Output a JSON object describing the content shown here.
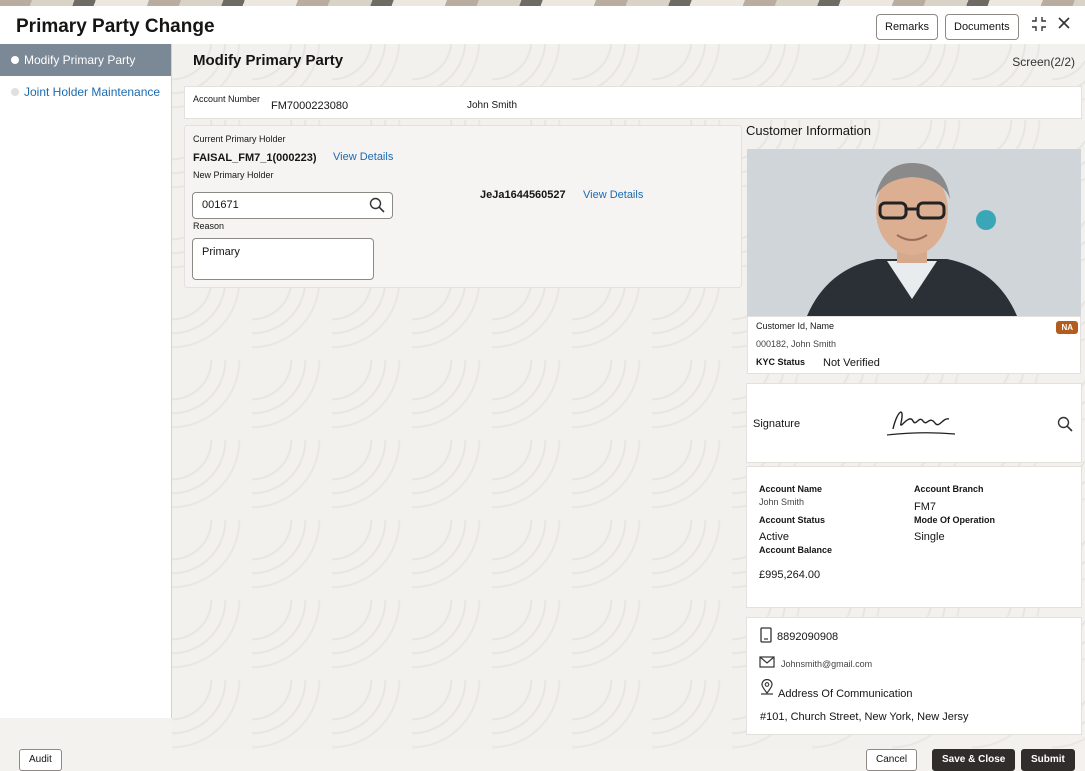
{
  "header": {
    "title": "Primary Party Change",
    "remarks_label": "Remarks",
    "documents_label": "Documents"
  },
  "sidebar": {
    "items": [
      {
        "label": "Modify Primary Party"
      },
      {
        "label": "Joint Holder Maintenance"
      }
    ]
  },
  "main": {
    "section_title": "Modify Primary Party",
    "screen_indicator": "Screen(2/2)",
    "account": {
      "number_label": "Account Number",
      "number_value": "FM7000223080",
      "name": "John Smith"
    },
    "holder": {
      "current_label": "Current Primary Holder",
      "current_value": "FAISAL_FM7_1(000223)",
      "view_details": "View Details",
      "new_label": "New Primary Holder",
      "new_value": "001671",
      "new_id": "JeJa1644560527",
      "reason_label": "Reason",
      "reason_value": "Primary"
    }
  },
  "customer": {
    "title": "Customer Information",
    "id_name_label": "Customer Id, Name",
    "id_name_value": "000182, John Smith",
    "badge": "NA",
    "kyc_label": "KYC Status",
    "kyc_value": "Not Verified",
    "signature_label": "Signature",
    "account_name_label": "Account Name",
    "account_name_value": "John Smith",
    "account_branch_label": "Account Branch",
    "account_branch_value": "FM7",
    "account_status_label": "Account Status",
    "account_status_value": "Active",
    "mode_label": "Mode Of Operation",
    "mode_value": "Single",
    "balance_label": "Account Balance",
    "balance_value": "£995,264.00",
    "phone": "8892090908",
    "email": "Johnsmith@gmail.com",
    "address_label": "Address Of Communication",
    "address_value": "#101, Church Street, New York, New Jersy"
  },
  "footer": {
    "audit_label": "Audit",
    "cancel_label": "Cancel",
    "save_close_label": "Save & Close",
    "submit_label": "Submit"
  },
  "icons": {
    "search": "search-icon",
    "minimize": "minimize-icon",
    "close": "close-icon",
    "phone": "phone-icon",
    "mail": "mail-icon",
    "location": "location-icon"
  },
  "colors": {
    "link": "#1c6bb0",
    "active_sidebar": "#7b8896",
    "badge": "#b35c1e",
    "dark_button": "#312d2a"
  }
}
